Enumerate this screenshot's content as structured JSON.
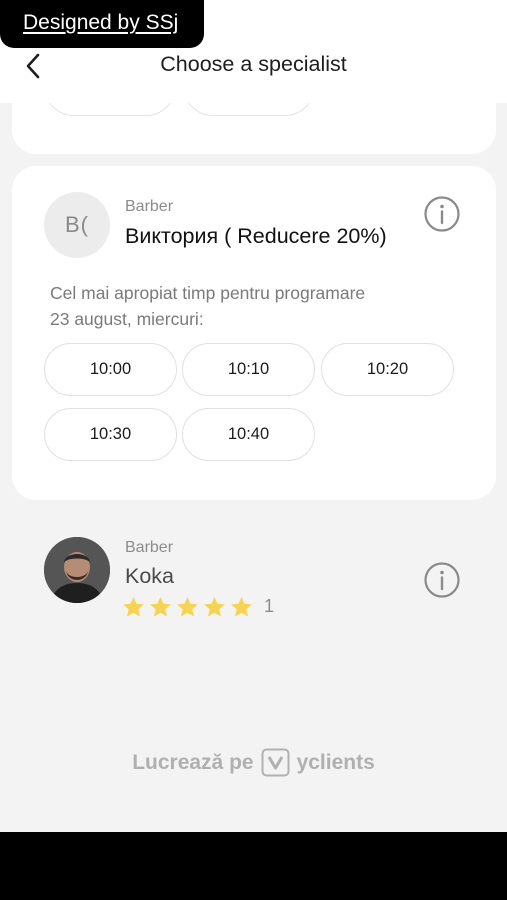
{
  "badge": {
    "text": "Designed by SSj"
  },
  "header": {
    "title": "Choose a specialist"
  },
  "specialists": [
    {
      "initials": "B(",
      "role": "Barber",
      "name": "Виктория ( Reducere 20%)",
      "nearest_line1": "Cel mai apropiat timp pentru programare",
      "nearest_line2": "23 august, miercuri:",
      "slots": [
        "10:00",
        "10:10",
        "10:20",
        "10:30",
        "10:40"
      ]
    },
    {
      "role": "Barber",
      "name": "Koka",
      "rating": 5,
      "reviews": "1"
    }
  ],
  "footer": {
    "prefix": "Lucrează pe",
    "brand": "yclients"
  },
  "colors": {
    "star": "#f6d451",
    "background": "#f3f3f3",
    "card": "#ffffff"
  },
  "icons": [
    "back-arrow-icon",
    "info-icon",
    "star-icon",
    "yclients-logo-icon"
  ]
}
